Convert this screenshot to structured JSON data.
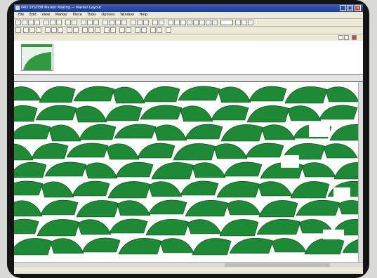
{
  "window": {
    "title": "PAD SYSTEM Marker Making — Marker Layout",
    "minimize_label": "_",
    "maximize_label": "□",
    "close_label": "×"
  },
  "menubar": {
    "items": [
      "File",
      "Edit",
      "View",
      "Marker",
      "Piece",
      "Tools",
      "Options",
      "Window",
      "Help"
    ]
  },
  "toolbar": {
    "zoom_value": ""
  },
  "thumbnail": {
    "selected_marker": 1
  },
  "statusbar": {
    "left_text": "",
    "right_text": ""
  },
  "colors": {
    "piece_fill": "#1f8a36",
    "piece_stroke": "#0b3d17",
    "titlebar": "#2a4aa6",
    "marker_background": "#ffffff"
  }
}
